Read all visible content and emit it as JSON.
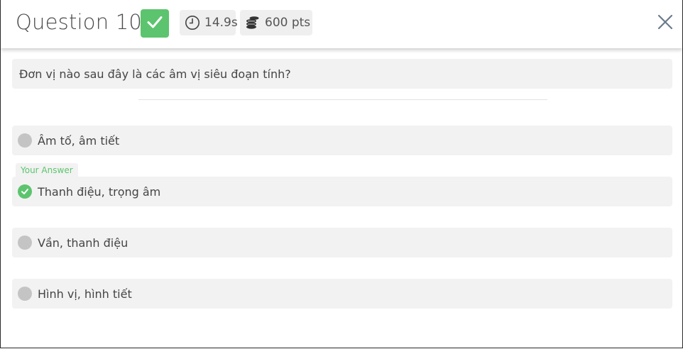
{
  "header": {
    "title": "Question 10",
    "time": "14.9s",
    "points": "600 pts",
    "status_color": "#5cc46e"
  },
  "question": {
    "text": "Đơn vị nào sau đây là các âm vị siêu đoạn tính?"
  },
  "your_answer_label": "Your Answer",
  "options": [
    {
      "label": "Âm tố, âm tiết",
      "selected": false
    },
    {
      "label": "Thanh điệu, trọng âm",
      "selected": true
    },
    {
      "label": "Vần, thanh điệu",
      "selected": false
    },
    {
      "label": "Hình vị, hình tiết",
      "selected": false
    }
  ],
  "icons": {
    "correct": "check-icon",
    "timer": "clock-icon",
    "points": "coins-icon",
    "close": "close-icon"
  }
}
